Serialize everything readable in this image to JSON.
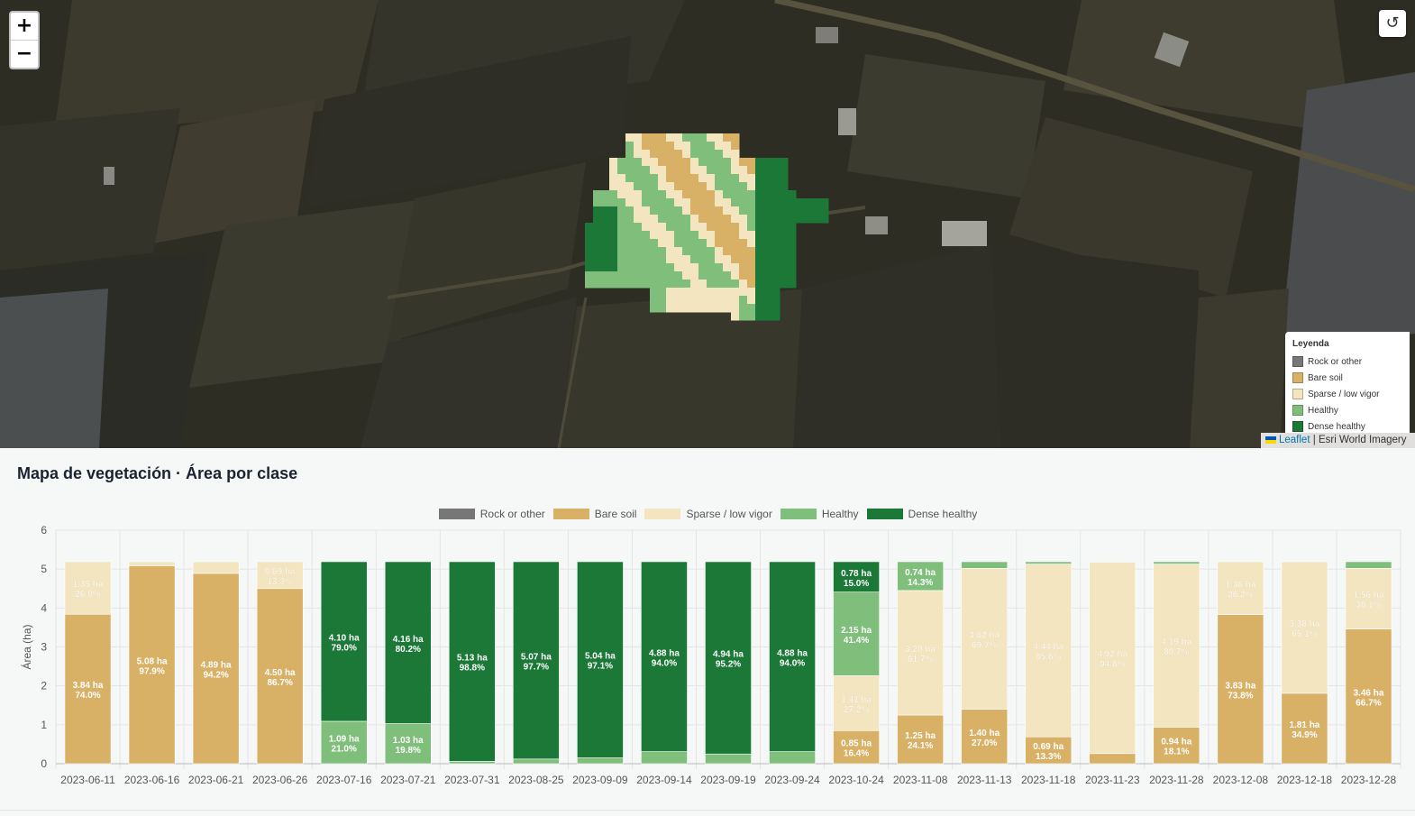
{
  "map": {
    "zoom_in_label": "+",
    "zoom_out_label": "−",
    "reset_icon": "reset-view-icon",
    "reset_glyph": "↺",
    "legend": {
      "title": "Leyenda",
      "items": [
        {
          "label": "Rock or other",
          "color": "#777777"
        },
        {
          "label": "Bare soil",
          "color": "#d9b166"
        },
        {
          "label": "Sparse / low vigor",
          "color": "#f3e5c0"
        },
        {
          "label": "Healthy",
          "color": "#7fbf7b"
        },
        {
          "label": "Dense healthy",
          "color": "#1b7837"
        }
      ]
    },
    "attribution": {
      "leaflet": "Leaflet",
      "separator": "|",
      "imagery": "Esri World Imagery"
    }
  },
  "chart_title": "Mapa de vegetación · Área por clase",
  "chart_data": {
    "type": "bar",
    "stacked": true,
    "ylabel": "Área (ha)",
    "xlabel": "",
    "ylim": [
      0,
      6
    ],
    "yticks": [
      0,
      1,
      2,
      3,
      4,
      5,
      6
    ],
    "grid": true,
    "legend_position": "top",
    "categories": [
      "2023-06-11",
      "2023-06-16",
      "2023-06-21",
      "2023-06-26",
      "2023-07-16",
      "2023-07-21",
      "2023-07-31",
      "2023-08-25",
      "2023-09-09",
      "2023-09-14",
      "2023-09-19",
      "2023-09-24",
      "2023-10-24",
      "2023-11-08",
      "2023-11-13",
      "2023-11-18",
      "2023-11-23",
      "2023-11-28",
      "2023-12-08",
      "2023-12-18",
      "2023-12-28"
    ],
    "series": [
      {
        "name": "Rock or other",
        "color": "#777777",
        "values": [
          0,
          0,
          0,
          0,
          0,
          0,
          0,
          0,
          0,
          0,
          0,
          0,
          0,
          0,
          0,
          0,
          0,
          0,
          0,
          0,
          0
        ],
        "labels": [
          "",
          "",
          "",
          "",
          "",
          "",
          "",
          "",
          "",
          "",
          "",
          "",
          "",
          "",
          "",
          "",
          "",
          "",
          "",
          "",
          ""
        ]
      },
      {
        "name": "Bare soil",
        "color": "#d9b166",
        "values": [
          3.84,
          5.08,
          4.89,
          4.5,
          0,
          0,
          0,
          0,
          0,
          0,
          0,
          0,
          0.85,
          1.25,
          1.4,
          0.69,
          0.26,
          0.94,
          3.83,
          1.81,
          3.46
        ],
        "labels": [
          "3.84 ha\n74.0%",
          "5.08 ha\n97.9%",
          "4.89 ha\n94.2%",
          "4.50 ha\n86.7%",
          "",
          "",
          "",
          "",
          "",
          "",
          "",
          "",
          "0.85 ha\n16.4%",
          "1.25 ha\n24.1%",
          "1.40 ha\n27.0%",
          "0.69 ha\n13.3%",
          "",
          "0.94 ha\n18.1%",
          "3.83 ha\n73.8%",
          "1.81 ha\n34.9%",
          "3.46 ha\n66.7%"
        ]
      },
      {
        "name": "Sparse / low vigor",
        "color": "#f3e5c0",
        "values": [
          1.35,
          0.11,
          0.3,
          0.69,
          0,
          0,
          0,
          0,
          0,
          0,
          0,
          0,
          1.41,
          3.2,
          3.62,
          4.44,
          4.92,
          4.19,
          1.36,
          3.38,
          1.56
        ],
        "labels": [
          "1.35 ha\n26.0%",
          "",
          "",
          "0.69 ha\n13.3%",
          "",
          "",
          "",
          "",
          "",
          "",
          "",
          "",
          "1.41 ha\n27.2%",
          "3.20 ha\n61.7%",
          "3.62 ha\n69.7%",
          "4.44 ha\n85.6%",
          "4.92 ha\n94.8%",
          "4.19 ha\n80.7%",
          "1.36 ha\n26.2%",
          "3.38 ha\n65.1%",
          "1.56 ha\n30.1%"
        ]
      },
      {
        "name": "Healthy",
        "color": "#7fbf7b",
        "values": [
          0,
          0,
          0,
          0,
          1.09,
          1.03,
          0.06,
          0.12,
          0.15,
          0.31,
          0.25,
          0.31,
          2.15,
          0.74,
          0.17,
          0.06,
          0,
          0.06,
          0,
          0,
          0.17
        ],
        "labels": [
          "",
          "",
          "",
          "",
          "1.09 ha\n21.0%",
          "1.03 ha\n19.8%",
          "",
          "",
          "",
          "",
          "",
          "",
          "2.15 ha\n41.4%",
          "0.74 ha\n14.3%",
          "",
          "",
          "",
          "",
          "",
          "",
          ""
        ]
      },
      {
        "name": "Dense healthy",
        "color": "#1b7837",
        "values": [
          0,
          0,
          0,
          0,
          4.1,
          4.16,
          5.13,
          5.07,
          5.04,
          4.88,
          4.94,
          4.88,
          0.78,
          0,
          0,
          0,
          0,
          0,
          0,
          0,
          0
        ],
        "labels": [
          "",
          "",
          "",
          "",
          "4.10 ha\n79.0%",
          "4.16 ha\n80.2%",
          "5.13 ha\n98.8%",
          "5.07 ha\n97.7%",
          "5.04 ha\n97.1%",
          "4.88 ha\n94.0%",
          "4.94 ha\n95.2%",
          "4.88 ha\n94.0%",
          "0.78 ha\n15.0%",
          "",
          "",
          "",
          "",
          "",
          "",
          "",
          ""
        ]
      }
    ]
  }
}
